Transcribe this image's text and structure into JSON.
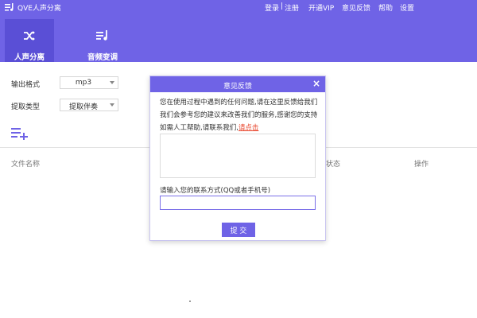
{
  "app": {
    "title": "QVE人声分离",
    "accent": "#6f63e6"
  },
  "top_links": {
    "login": "登录",
    "separator": "|",
    "register": "注册",
    "vip": "开通VIP",
    "feedback": "意见反馈",
    "help": "帮助",
    "settings": "设置"
  },
  "tabs": [
    {
      "label": "人声分离",
      "icon": "shuffle-icon",
      "active": true
    },
    {
      "label": "音频变调",
      "icon": "music-list-icon",
      "active": false
    }
  ],
  "settings": {
    "output_format_label": "输出格式",
    "output_format_value": "mp3",
    "extract_type_label": "提取类型",
    "extract_type_value": "提取伴奏"
  },
  "table": {
    "columns": [
      "文件名称",
      "状态",
      "操作"
    ]
  },
  "dialog": {
    "title": "意见反馈",
    "close": "×",
    "description": "您在使用过程中遇到的任何问题,请在这里反馈给我们我们会参考您的建议来改善我们的服务,感谢您的支持如需人工帮助,请联系我们,",
    "link_text": "请点击",
    "feedback_value": "",
    "contact_label": "请输入您的联系方式(QQ或者手机号)",
    "contact_value": "",
    "submit_label": "提 交"
  }
}
